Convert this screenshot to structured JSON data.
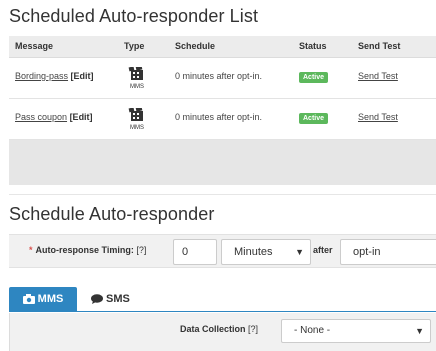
{
  "list_section": {
    "title": "Scheduled Auto-responder List",
    "columns": [
      "Message",
      "Type",
      "Schedule",
      "Status",
      "Send Test"
    ],
    "rows": [
      {
        "message": "Bording-pass",
        "edit": "[Edit]",
        "type": "MMS",
        "schedule": "0 minutes after opt-in.",
        "status": "Active",
        "send_test": "Send Test"
      },
      {
        "message": "Pass coupon",
        "edit": "[Edit]",
        "type": "MMS",
        "schedule": "0 minutes after opt-in.",
        "status": "Active",
        "send_test": "Send Test"
      }
    ]
  },
  "form_section": {
    "title": "Schedule Auto-responder",
    "timing": {
      "required_mark": "*",
      "label": "Auto-response Timing:",
      "help": "[?]",
      "value": "0",
      "unit": "Minutes",
      "after_label": "after",
      "event": "opt-in"
    },
    "tabs": [
      {
        "label": "MMS",
        "icon": "camera-icon",
        "active": true
      },
      {
        "label": "SMS",
        "icon": "chat-bubble-icon",
        "active": false
      }
    ],
    "data_collection": {
      "label": "Data Collection",
      "help": "[?]",
      "selected": "- None -"
    }
  },
  "colors": {
    "accent": "#2e86c1",
    "status_active": "#5cb85c",
    "required": "#d9534f"
  }
}
